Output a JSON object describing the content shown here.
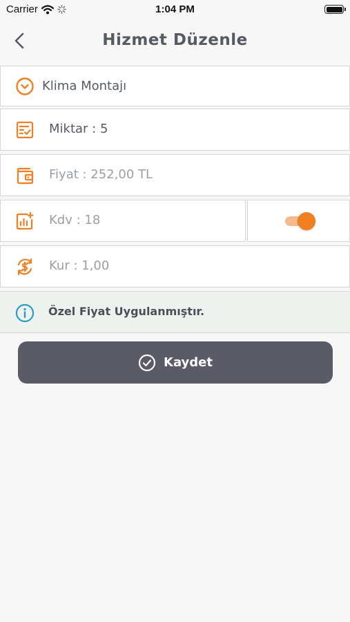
{
  "status_bar": {
    "carrier": "Carrier",
    "time": "1:04 PM",
    "icons": [
      "wifi-icon",
      "activity-spinner-icon",
      "battery-icon"
    ]
  },
  "nav": {
    "title": "Hizmet Düzenle",
    "back_icon": "chevron-left-icon"
  },
  "form": {
    "service": {
      "value": "Klima Montajı",
      "icon": "chevron-down-circle-icon"
    },
    "quantity": {
      "text": "Miktar : 5",
      "icon": "checklist-icon"
    },
    "price": {
      "text": "Fiyat : 252,00 TL",
      "icon": "wallet-icon"
    },
    "vat": {
      "text": "Kdv : 18",
      "icon": "chart-plus-icon",
      "toggle_on": true
    },
    "rate": {
      "text": "Kur : 1,00",
      "icon": "currency-exchange-icon"
    }
  },
  "info": {
    "text": "Özel Fiyat Uygulanmıştır.",
    "icon": "info-icon"
  },
  "actions": {
    "save_label": "Kaydet",
    "save_icon": "check-circle-icon"
  },
  "colors": {
    "accent": "#f07f22",
    "info_icon": "#2a9bc4",
    "button_bg": "#5a5b66",
    "background": "#f7f7f7"
  }
}
